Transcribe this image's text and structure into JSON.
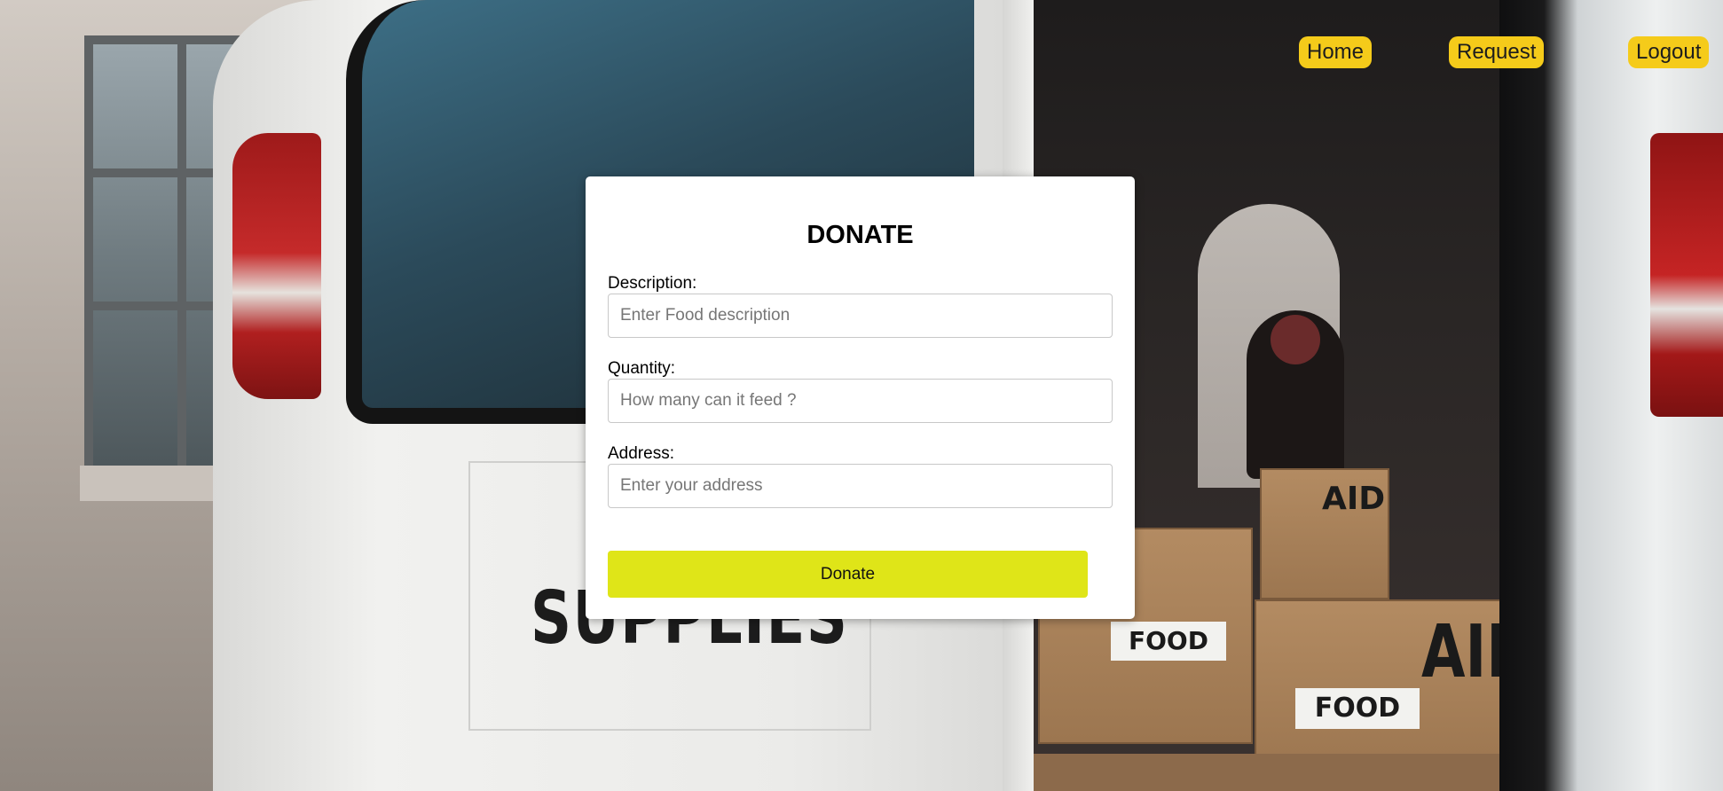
{
  "nav": {
    "items": [
      {
        "label": "Home"
      },
      {
        "label": "Request"
      },
      {
        "label": "Logout"
      }
    ]
  },
  "form": {
    "title": "DONATE",
    "description": {
      "label": "Description:",
      "placeholder": "Enter Food description",
      "value": ""
    },
    "quantity": {
      "label": "Quantity:",
      "placeholder": "How many can it feed ?",
      "value": ""
    },
    "address": {
      "label": "Address:",
      "placeholder": "Enter your address",
      "value": ""
    },
    "submit_label": "Donate"
  },
  "background": {
    "van_text": "SUPPLIES",
    "box_labels": [
      "AID",
      "FOOD",
      "AID",
      "FOOD"
    ]
  },
  "colors": {
    "nav_button": "#f5cb1a",
    "submit_button": "#dfe518",
    "card": "#ffffff"
  }
}
